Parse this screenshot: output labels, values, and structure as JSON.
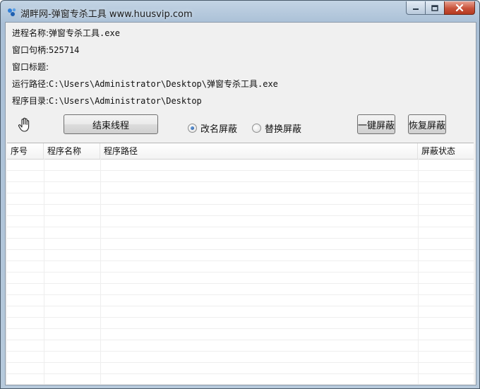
{
  "window": {
    "title": "湖畔网-弹窗专杀工具 www.huusvip.com"
  },
  "info": {
    "process_name_label": "进程名称:",
    "process_name_value": "弹窗专杀工具.exe",
    "handle_label": "窗口句柄:",
    "handle_value": "525714",
    "window_title_label": "窗口标题:",
    "window_title_value": "",
    "run_path_label": "运行路径:",
    "run_path_value": "C:\\Users\\Administrator\\Desktop\\弹窗专杀工具.exe",
    "program_dir_label": "程序目录:",
    "program_dir_value": "C:\\Users\\Administrator\\Desktop"
  },
  "controls": {
    "end_thread_label": "结束线程",
    "rename_block_label": "改名屏蔽",
    "replace_block_label": "替换屏蔽",
    "one_key_block_label": "一键屏蔽",
    "restore_block_label": "恢复屏蔽",
    "selected_mode": "rename"
  },
  "table": {
    "columns": [
      "序号",
      "程序名称",
      "程序路径",
      "屏蔽状态"
    ],
    "rows": []
  },
  "icons": {
    "app": "app-logo-icon",
    "finder": "hand-finder-icon",
    "minimize": "minimize-icon",
    "maximize": "maximize-icon",
    "close": "close-icon"
  }
}
